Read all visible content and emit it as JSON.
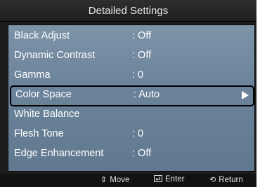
{
  "header": {
    "title": "Detailed Settings"
  },
  "menu": {
    "items": [
      {
        "label": "Black Adjust",
        "value": ": Off"
      },
      {
        "label": "Dynamic Contrast",
        "value": ": Off"
      },
      {
        "label": "Gamma",
        "value": ": 0"
      },
      {
        "label": "Color Space",
        "value": ": Auto",
        "selected": true
      },
      {
        "label": "White Balance",
        "value": ""
      },
      {
        "label": "Flesh Tone",
        "value": ": 0"
      },
      {
        "label": "Edge Enhancement",
        "value": ": Off"
      }
    ]
  },
  "footer": {
    "move_label": "Move",
    "enter_label": "Enter",
    "return_label": "Return",
    "move_icon": "up-down-arrows-icon",
    "enter_icon": "enter-icon",
    "return_icon": "return-icon"
  },
  "colors": {
    "panel": "#6c849b",
    "background": "#1c1c1c",
    "text": "#ffffff"
  }
}
